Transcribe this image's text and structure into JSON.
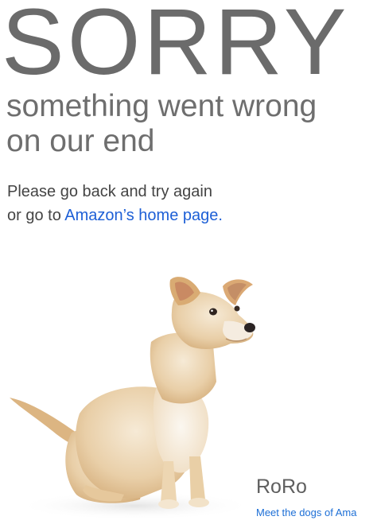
{
  "error": {
    "headline": "SORRY",
    "subhead_line1": "something went wrong",
    "subhead_line2": "on our end",
    "message_line1": "Please go back and try again",
    "message_line2_prefix": "or go to ",
    "home_link_text": "Amazon’s home page."
  },
  "dog": {
    "image_icon": "dog-photo",
    "name": "RoRo",
    "link_text": "Meet the dogs of Ama"
  },
  "colors": {
    "link": "#1d5fd6",
    "headline": "#6b6b6b",
    "body_text": "#444444"
  }
}
